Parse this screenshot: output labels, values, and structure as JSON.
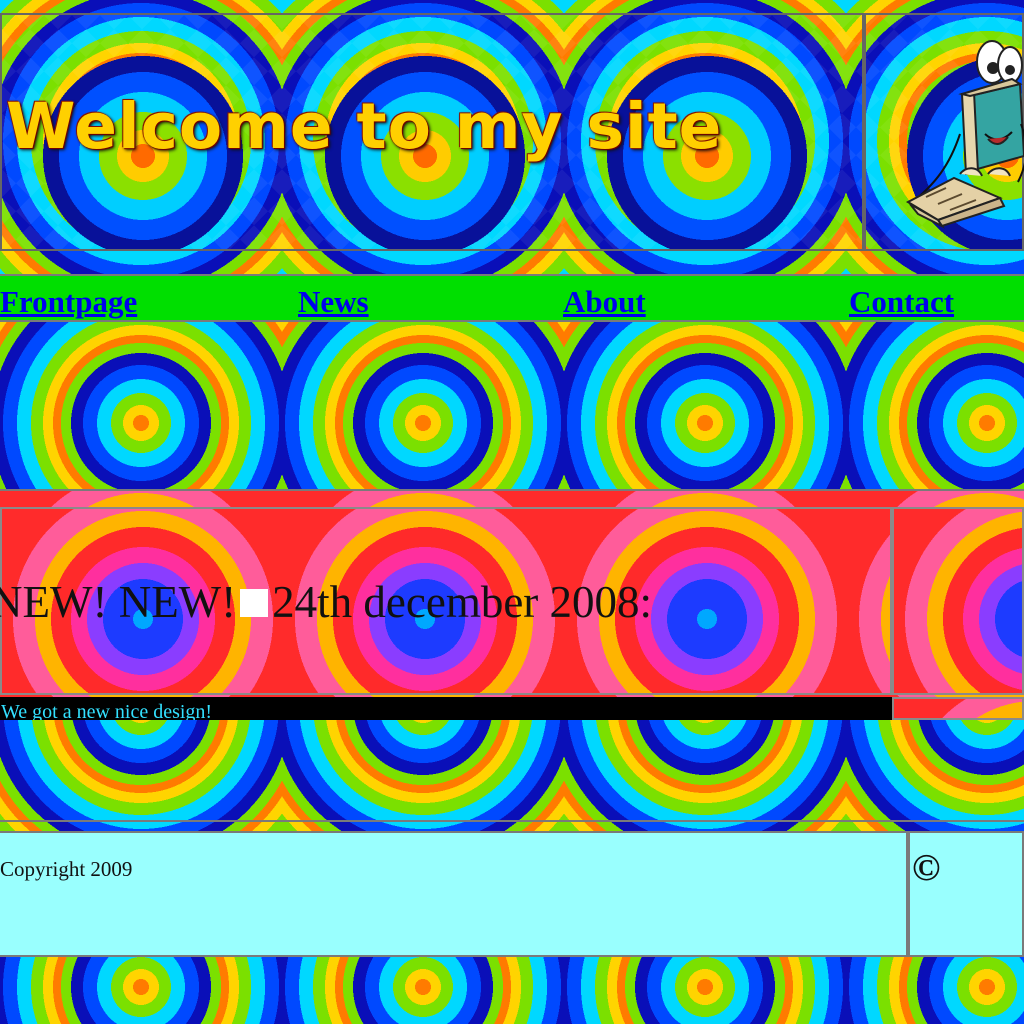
{
  "header": {
    "title": "Welcome to my site"
  },
  "nav": {
    "items": [
      {
        "label": "Frontpage"
      },
      {
        "label": "News"
      },
      {
        "label": "About"
      },
      {
        "label": "Contact"
      }
    ]
  },
  "news": {
    "headline_prefix": "NEW! NEW!",
    "headline_date": "24th december 2008:",
    "body": "We got a new nice design!"
  },
  "footer": {
    "copyright": "Copyright 2009",
    "symbol": "©"
  },
  "colors": {
    "nav_bar": "#00df00",
    "link": "#0000ee",
    "footer_bg": "#99fffe",
    "news_text": "#33e1ff"
  }
}
